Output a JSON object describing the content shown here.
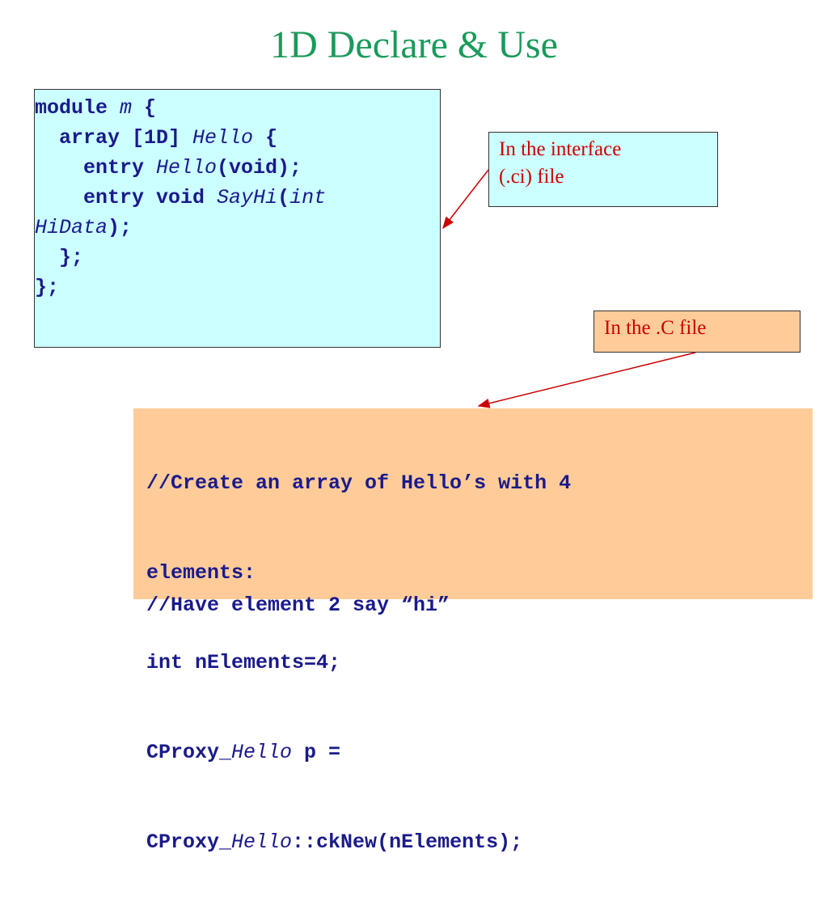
{
  "title": "1D Declare & Use",
  "interface_note": {
    "line1": "In the interface",
    "line2": "(.ci) file"
  },
  "c_note": {
    "text": "In the .C file"
  },
  "ci_code": {
    "l1_kw": "module ",
    "l1_name": "m",
    "l1_end": " {",
    "l2_kw": "  array [1D] ",
    "l2_name": "Hello",
    "l2_end": " {",
    "l3_kw": "    entry ",
    "l3_name": "Hello",
    "l3_end": "(void);",
    "l4_kw": "    entry void ",
    "l4_name": "SayHi",
    "l4_paren": "(",
    "l4_type": "int",
    "l5_name": "HiData",
    "l5_end": ");",
    "l6": "  };",
    "l7": "};"
  },
  "c_code": {
    "l1": "//Create an array of Hello’s with 4",
    "l2": "elements:",
    "l3": "int nElements=4;",
    "l4_a": "CProxy_",
    "l4_b": "Hello",
    "l4_c": " p =",
    "l5_a": "CProxy_",
    "l5_b": "Hello",
    "l5_c": "::ckNew(nElements);",
    "l6": "//Have element 2 say “hi”"
  },
  "colors": {
    "title": "#1a9a5a",
    "code": "#1a1a8c",
    "note_text": "#cc0000",
    "interface_box": "#ccffff",
    "c_box": "#ffcc99",
    "arrow": "#cc0000"
  }
}
